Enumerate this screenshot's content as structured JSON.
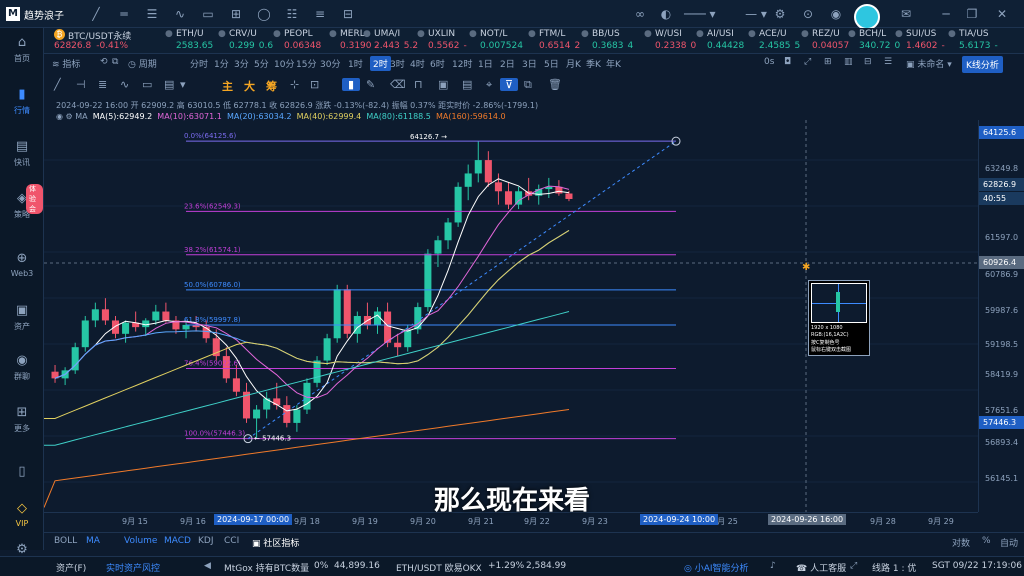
{
  "app": {
    "name": "趋势浪子"
  },
  "tickers": [
    {
      "name": "BTC/USDT永续",
      "price": "62826.8",
      "change": "-0.41%",
      "dir": "dn"
    },
    {
      "name": "ETH/U",
      "price": "2583.65",
      "change": "",
      "dir": "up"
    },
    {
      "name": "CRV/U",
      "price": "0.299",
      "change": "0.6",
      "dir": "up"
    },
    {
      "name": "PEOPL",
      "price": "0.06348",
      "change": "",
      "dir": "dn"
    },
    {
      "name": "MERL",
      "price": "0.3190",
      "change": "-",
      "dir": "dn"
    },
    {
      "name": "UMA/I",
      "price": "2.443",
      "change": "5.2",
      "dir": "dn"
    },
    {
      "name": "UXLIN",
      "price": "0.5562",
      "change": "-",
      "dir": "dn"
    },
    {
      "name": "NOT/L",
      "price": "0.007524",
      "change": "",
      "dir": "up"
    },
    {
      "name": "FTM/L",
      "price": "0.6514",
      "change": "2",
      "dir": "dn"
    },
    {
      "name": "BB/US",
      "price": "0.3683",
      "change": "4",
      "dir": "up"
    },
    {
      "name": "W/USI",
      "price": "0.2338",
      "change": "0",
      "dir": "dn"
    },
    {
      "name": "AI/USI",
      "price": "0.44428",
      "change": "",
      "dir": "up"
    },
    {
      "name": "ACE/U",
      "price": "2.4585",
      "change": "5",
      "dir": "up"
    },
    {
      "name": "REZ/U",
      "price": "0.04057",
      "change": "",
      "dir": "dn"
    },
    {
      "name": "BCH/L",
      "price": "340.72",
      "change": "0",
      "dir": "up"
    },
    {
      "name": "SUI/US",
      "price": "1.4602",
      "change": "-",
      "dir": "dn"
    },
    {
      "name": "TIA/US",
      "price": "5.6173",
      "change": "-",
      "dir": "up"
    }
  ],
  "sidebar": [
    {
      "label": "首页",
      "icon": "home-icon",
      "glyph": "⌂"
    },
    {
      "label": "行情",
      "icon": "chart-icon",
      "glyph": "▮"
    },
    {
      "label": "快讯",
      "icon": "news-icon",
      "glyph": "▤"
    },
    {
      "label": "策略",
      "icon": "strategy-icon",
      "glyph": "◈"
    },
    {
      "label": "Web3",
      "icon": "web3-icon",
      "glyph": "⊕"
    },
    {
      "label": "资产",
      "icon": "wallet-icon",
      "glyph": "▣"
    },
    {
      "label": "群聊",
      "icon": "chat-icon",
      "glyph": "◉"
    },
    {
      "label": "更多",
      "icon": "grid-icon",
      "glyph": "⊞"
    },
    {
      "label": "VIP",
      "icon": "diamond-icon",
      "glyph": "◇"
    }
  ],
  "sidebar_badge": "体验会",
  "toolbar": {
    "indicator": "指标",
    "period": "周期",
    "timeframes": [
      "分时",
      "1分",
      "3分",
      "5分",
      "10分",
      "15分",
      "30分",
      "1时",
      "2时",
      "3时",
      "4时",
      "6时",
      "12时",
      "1日",
      "2日",
      "3日",
      "5日",
      "月K",
      "季K",
      "年K"
    ],
    "selected": "2时",
    "zoom": "0s",
    "unnamed": "未命名",
    "k_analysis": "K线分析"
  },
  "drawtools": {
    "main": "主",
    "big": "大",
    "chip": "筹"
  },
  "info": {
    "line1": "2024-09-22 16:00  开 62909.2  高 63010.5  低 62778.1  收 62826.9  涨跌 -0.13%(-82.4)  振幅 0.37%  距实时价 -2.86%(-1799.1)",
    "ma_label": "MA",
    "ma5": "MA(5):62949.2",
    "ma10": "MA(10):63071.1",
    "ma20": "MA(20):63034.2",
    "ma40": "MA(40):62999.4",
    "ma80": "MA(80):61188.5",
    "ma160": "MA(160):59614.0"
  },
  "fib": [
    {
      "label": "0.0%(64125.6)",
      "price": 64125.6,
      "color": "#7b6cf0"
    },
    {
      "label": "23.6%(62549.3)",
      "price": 62549.3,
      "color": "#c13fd8"
    },
    {
      "label": "38.2%(61574.1)",
      "price": 61574.1,
      "color": "#c13fd8"
    },
    {
      "label": "50.0%(60786.0)",
      "price": 60786.0,
      "color": "#3d8bff"
    },
    {
      "label": "61.8%(59997.8)",
      "price": 59997.8,
      "color": "#3d8bff"
    },
    {
      "label": "76.4%(59022.6)",
      "price": 59022.6,
      "color": "#c13fd8"
    },
    {
      "label": "100.0%(57446.3)",
      "price": 57446.3,
      "color": "#c13fd8"
    }
  ],
  "annotations": {
    "high": "64126.7",
    "low": "57446.3"
  },
  "price_axis": {
    "labels": [
      "63249.8",
      "61597.0",
      "60786.9",
      "59987.6",
      "59198.5",
      "58419.9",
      "57651.6",
      "56893.4",
      "56145.1"
    ],
    "top_tag": "64125.6",
    "current": "62826.9",
    "countdown": "40:55",
    "bottom_tag": "57446.3",
    "crosshair": "60926.4"
  },
  "date_axis": {
    "labels": [
      "9月 15",
      "9月 16",
      "9月 18",
      "9月 19",
      "9月 20",
      "9月 21",
      "9月 22",
      "9月 23",
      "9月 25",
      "9月 28",
      "9月 29"
    ],
    "tag_start": "2024-09-17 00:00",
    "tag_end": "2024-09-24 10:00",
    "tag_cursor": "2024-09-26 16:00"
  },
  "indicators": {
    "items": [
      "BOLL",
      "MA",
      "Volume",
      "MACD",
      "KDJ",
      "CCI"
    ],
    "community": "社区指标",
    "right": [
      "对数",
      "%",
      "自动"
    ]
  },
  "status": {
    "asset": "资产(F)",
    "risk": "实时资产风控",
    "mtgox": "MtGox 持有BTC数量",
    "mtgox_pct": "0%",
    "mtgox_val": "44,899.16",
    "eth": "ETH/USDT 欧易OKX",
    "eth_chg": "+1.29%",
    "eth_px": "2,584.99",
    "ai": "小AI智能分析",
    "service": "人工客服",
    "line": "线路 1 : 优",
    "time": "SGT 09/22 17:19:06"
  },
  "subtitle": "那么现在来看",
  "popup": {
    "res": "1920 x 1080",
    "rgb": "RGB:(16,1A2C)",
    "copy": "按C复制色号",
    "tip": "鼠标右键双击截图"
  },
  "chart_data": {
    "type": "candlestick",
    "symbol": "BTC/USDT",
    "timeframe": "2H",
    "ylim": [
      55800,
      64600
    ],
    "x_labels": [
      "9月 15",
      "9月 16",
      "9月 17",
      "9月 18",
      "9月 19",
      "9月 20",
      "9月 21",
      "9月 22",
      "9月 23"
    ],
    "colors": {
      "up": "#26c6a5",
      "down": "#f0556c"
    },
    "candles": [
      [
        58950,
        59100,
        58700,
        58800
      ],
      [
        58800,
        59050,
        58650,
        58980
      ],
      [
        58980,
        59600,
        58900,
        59500
      ],
      [
        59500,
        60200,
        59400,
        60100
      ],
      [
        60100,
        60500,
        59950,
        60350
      ],
      [
        60350,
        60600,
        60000,
        60100
      ],
      [
        60100,
        60200,
        59700,
        59800
      ],
      [
        59800,
        60100,
        59600,
        60050
      ],
      [
        60050,
        60300,
        59850,
        59950
      ],
      [
        59950,
        60150,
        59750,
        60100
      ],
      [
        60100,
        60450,
        60000,
        60300
      ],
      [
        60300,
        60500,
        60050,
        60100
      ],
      [
        60100,
        60200,
        59800,
        59900
      ],
      [
        59900,
        60100,
        59700,
        60000
      ],
      [
        60000,
        60200,
        59850,
        59950
      ],
      [
        59950,
        60100,
        59600,
        59700
      ],
      [
        59700,
        59900,
        59200,
        59300
      ],
      [
        59300,
        59500,
        58700,
        58800
      ],
      [
        58800,
        59100,
        58400,
        58500
      ],
      [
        58500,
        58700,
        57800,
        57900
      ],
      [
        57900,
        58200,
        57450,
        58100
      ],
      [
        58100,
        58500,
        57900,
        58350
      ],
      [
        58350,
        58700,
        58100,
        58200
      ],
      [
        58200,
        58400,
        57700,
        57800
      ],
      [
        57800,
        58200,
        57600,
        58100
      ],
      [
        58100,
        58800,
        58000,
        58700
      ],
      [
        58700,
        59300,
        58600,
        59200
      ],
      [
        59200,
        59800,
        59100,
        59700
      ],
      [
        59700,
        60900,
        59600,
        60800
      ],
      [
        60800,
        60900,
        59700,
        59800
      ],
      [
        59800,
        60300,
        59600,
        60200
      ],
      [
        60200,
        60500,
        59900,
        60000
      ],
      [
        60000,
        60400,
        59800,
        60300
      ],
      [
        60300,
        60500,
        59500,
        59600
      ],
      [
        59600,
        59800,
        59300,
        59500
      ],
      [
        59500,
        60000,
        59400,
        59900
      ],
      [
        59900,
        60500,
        59800,
        60400
      ],
      [
        60400,
        61700,
        60300,
        61600
      ],
      [
        61600,
        62000,
        61300,
        61900
      ],
      [
        61900,
        62400,
        61700,
        62300
      ],
      [
        62300,
        63200,
        62200,
        63100
      ],
      [
        63100,
        63600,
        62800,
        63400
      ],
      [
        63400,
        64126.7,
        63200,
        63700
      ],
      [
        63700,
        63900,
        63100,
        63200
      ],
      [
        63200,
        63400,
        62700,
        63000
      ],
      [
        63000,
        63200,
        62600,
        62700
      ],
      [
        62700,
        63100,
        62600,
        63000
      ],
      [
        63000,
        63300,
        62800,
        62900
      ],
      [
        62900,
        63150,
        62700,
        63050
      ],
      [
        63050,
        63300,
        62850,
        63100
      ],
      [
        63100,
        63250,
        62900,
        62950
      ],
      [
        62950,
        63010.5,
        62778.1,
        62826.9
      ]
    ],
    "ma_lines": [
      {
        "name": "MA(5)",
        "color": "#ffffff"
      },
      {
        "name": "MA(10)",
        "color": "#e066d8"
      },
      {
        "name": "MA(20)",
        "color": "#5aa8ff"
      },
      {
        "name": "MA(40)",
        "color": "#e0d060"
      },
      {
        "name": "MA(80)",
        "color": "#3fd0c8"
      },
      {
        "name": "MA(160)",
        "color": "#f07a2a"
      }
    ]
  }
}
